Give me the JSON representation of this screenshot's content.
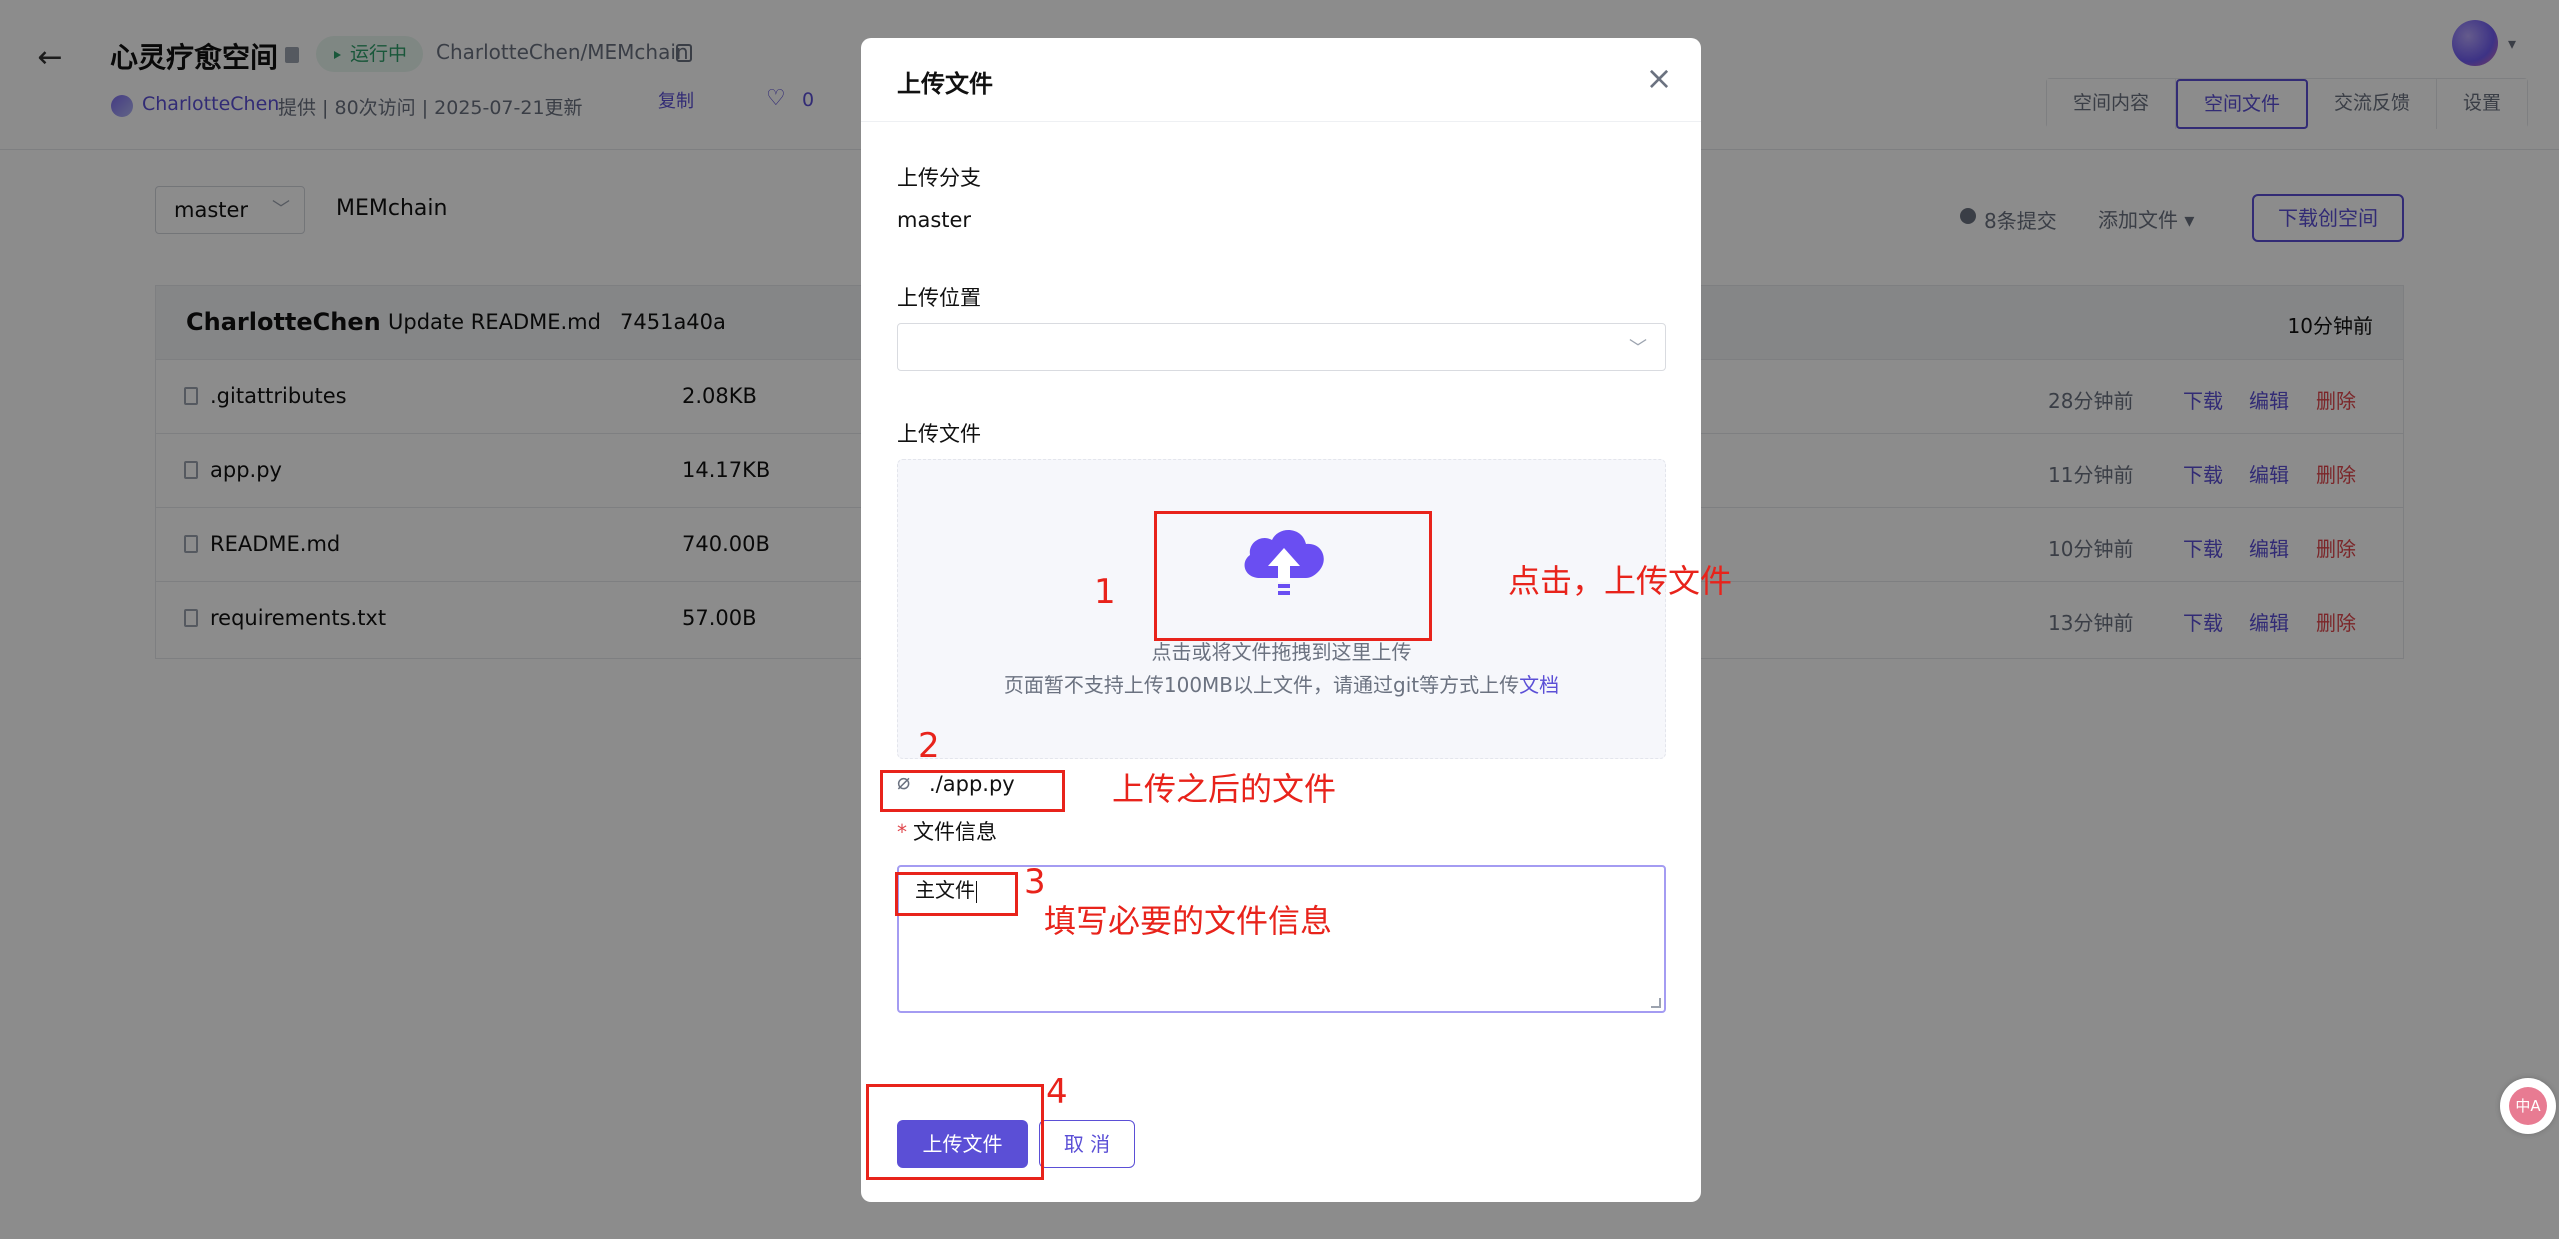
{
  "header": {
    "back_icon": "arrow-left-icon",
    "title": "心灵疗愈空间",
    "status": "运行中",
    "repo_path": "CharlotteChen/MEMchain",
    "user": "CharlotteChen",
    "meta_rest": "提供 | 80次访问 | 2025-07-21更新",
    "copy": "复制",
    "likes": "0",
    "tabs": [
      "空间内容",
      "空间文件",
      "交流反馈",
      "设置"
    ],
    "active_tab": "空间文件"
  },
  "toolbar": {
    "branch": "master",
    "repo_name": "MEMchain",
    "commits": "8条提交",
    "add_file": "添加文件 ▾",
    "download_space": "下载创空间"
  },
  "commit": {
    "author": "CharlotteChen",
    "message": "Update README.md",
    "hash": "7451a40a",
    "time": "10分钟前"
  },
  "files": [
    {
      "name": ".gitattributes",
      "size": "2.08KB",
      "time": "28分钟前"
    },
    {
      "name": "app.py",
      "size": "14.17KB",
      "time": "11分钟前"
    },
    {
      "name": "README.md",
      "size": "740.00B",
      "time": "10分钟前"
    },
    {
      "name": "requirements.txt",
      "size": "57.00B",
      "time": "13分钟前"
    }
  ],
  "file_actions": {
    "download": "下载",
    "edit": "编辑",
    "delete": "删除"
  },
  "modal": {
    "title": "上传文件",
    "branch_label": "上传分支",
    "branch_value": "master",
    "location_label": "上传位置",
    "location_value": "",
    "file_label": "上传文件",
    "dropzone_line1": "点击或将文件拖拽到这里上传",
    "dropzone_line2": "页面暂不支持上传100MB以上文件，请通过git等方式上传",
    "dropzone_link": "文档",
    "uploaded_file": "./app.py",
    "info_label": "文件信息",
    "info_value": "主文件",
    "submit": "上传文件",
    "cancel": "取 消"
  },
  "annotations": {
    "n1": "1",
    "n2": "2",
    "n3": "3",
    "n4": "4",
    "t1": "点击，上传文件",
    "t2": "上传之后的文件",
    "t3": "填写必要的文件信息"
  },
  "translate_fab": "中A",
  "colors": {
    "accent": "#5b4fd6",
    "danger": "#e0464c",
    "annotation": "#e8231b",
    "success": "#2f9e6a"
  }
}
